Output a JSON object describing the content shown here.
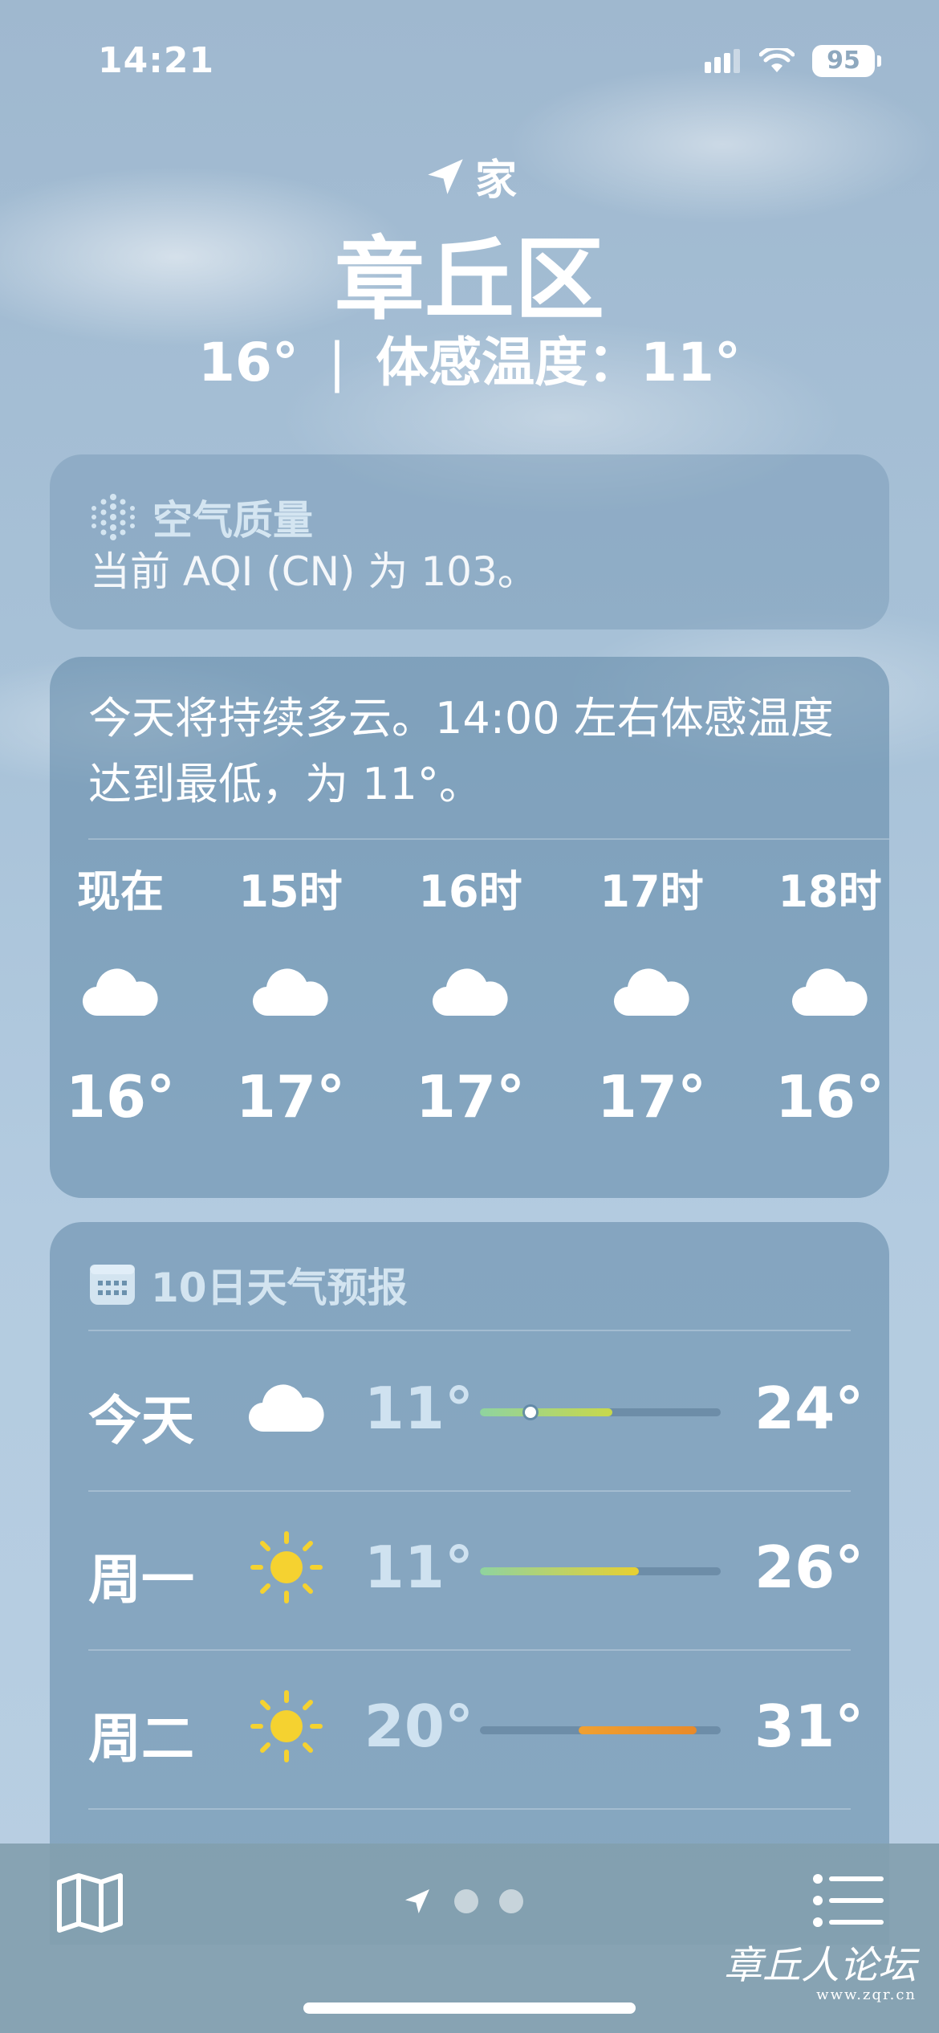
{
  "status_bar": {
    "time": "14:21",
    "battery": "95",
    "icons": [
      "signal-icon",
      "wifi-icon",
      "battery-icon"
    ]
  },
  "header": {
    "location_label": "家",
    "city": "章丘区",
    "temperature": "16°",
    "separator": "|",
    "feels_like": "体感温度：11°"
  },
  "aqi_card": {
    "title": "空气质量",
    "text": "当前 AQI (CN) 为 103。"
  },
  "hourly_card": {
    "summary": "今天将持续多云。14:00 左右体感温度达到最低，为 11°。",
    "hours": [
      {
        "label": "现在",
        "icon": "cloud-icon",
        "temp": "16°"
      },
      {
        "label": "15时",
        "icon": "cloud-icon",
        "temp": "17°"
      },
      {
        "label": "16时",
        "icon": "cloud-icon",
        "temp": "17°"
      },
      {
        "label": "17时",
        "icon": "cloud-icon",
        "temp": "17°"
      },
      {
        "label": "18时",
        "icon": "cloud-icon",
        "temp": "16°"
      }
    ]
  },
  "daily_card": {
    "title": "10日天气预报",
    "days": [
      {
        "name": "今天",
        "icon": "cloud-icon",
        "low": "11°",
        "high": "24°",
        "range_start": 0.0,
        "range_end": 0.55,
        "current": 0.21,
        "colors": [
          "#8fd3a0",
          "#c8d84a"
        ]
      },
      {
        "name": "周一",
        "icon": "sun-icon",
        "low": "11°",
        "high": "26°",
        "range_start": 0.0,
        "range_end": 0.66,
        "colors": [
          "#8fd3a0",
          "#e8d030"
        ]
      },
      {
        "name": "周二",
        "icon": "sun-icon",
        "low": "20°",
        "high": "31°",
        "range_start": 0.41,
        "range_end": 0.9,
        "colors": [
          "#f0a030",
          "#e88a2a"
        ]
      }
    ]
  },
  "bottom_bar": {
    "icons": [
      "map-icon",
      "location-arrow-icon",
      "list-icon"
    ],
    "page_count": 3
  },
  "watermark": {
    "text": "章丘人论坛",
    "url": "www.zqr.cn"
  },
  "colors": {
    "accent_yellow": "#f5d230",
    "sky": "#a8c2d8"
  }
}
